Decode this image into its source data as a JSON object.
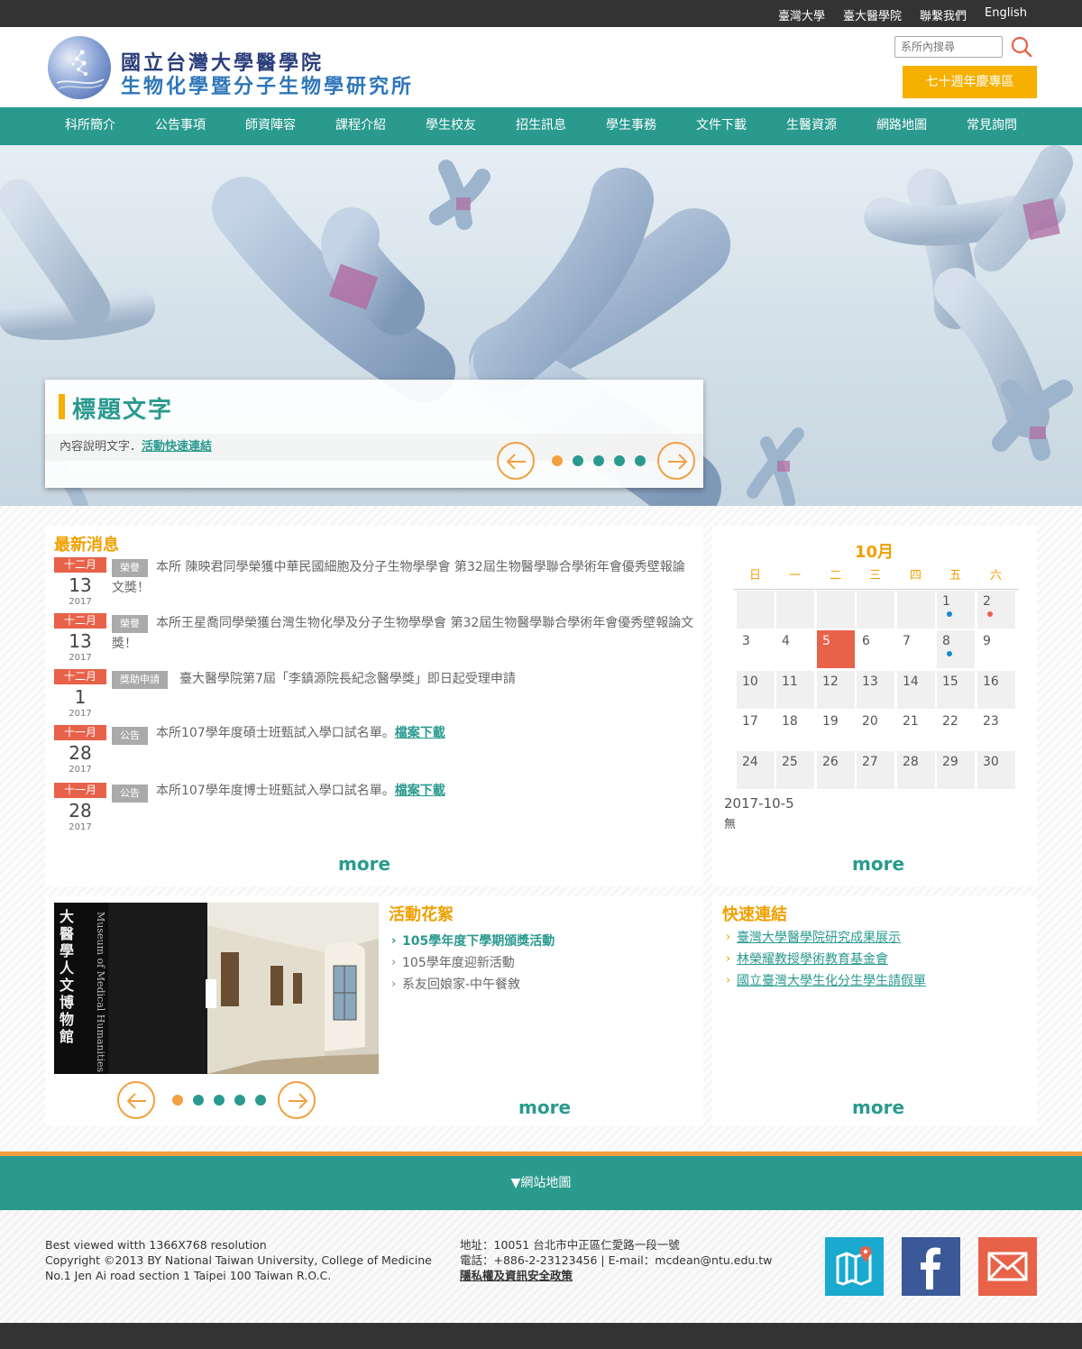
{
  "topbar": {
    "links": [
      "臺灣大學",
      "臺大醫學院",
      "聯繫我們",
      "English"
    ]
  },
  "header": {
    "logo_line1": "國立台灣大學醫學院",
    "logo_line2": "生物化學暨分子生物學研究所",
    "search_placeholder": "系所內搜尋",
    "search_icon": "search-icon",
    "anniversary_button": "七十週年慶專區"
  },
  "nav": {
    "items": [
      "科所簡介",
      "公告事項",
      "師資陣容",
      "課程介紹",
      "學生校友",
      "招生訊息",
      "學生事務",
      "文件下載",
      "生醫資源",
      "網路地圖",
      "常見詢問"
    ]
  },
  "banner": {
    "title": "標題文字",
    "desc": "內容說明文字．",
    "link": "活動快速連結",
    "slide_count": 5,
    "active_slide": 1
  },
  "news": {
    "title": "最新消息",
    "more": "more",
    "items": [
      {
        "month": "十二月",
        "day": "13",
        "year": "2017",
        "tag": "榮譽",
        "text": "本所 陳映君同學榮獲中華民國細胞及分子生物學學會 第32屆生物醫學聯合學術年會優秀壁報論文獎！",
        "link": ""
      },
      {
        "month": "十二月",
        "day": "13",
        "year": "2017",
        "tag": "榮譽",
        "text": "本所王星喬同學榮獲台灣生物化學及分子生物學學會 第32屆生物醫學聯合學術年會優秀壁報論文獎！",
        "link": ""
      },
      {
        "month": "十二月",
        "day": "1",
        "year": "2017",
        "tag": "獎助申請",
        "text": "臺大醫學院第7屆「李鎮源院長紀念醫學獎」即日起受理申請",
        "link": ""
      },
      {
        "month": "十一月",
        "day": "28",
        "year": "2017",
        "tag": "公告",
        "text": "本所107學年度碩士班甄試入學口試名單。",
        "link": "檔案下載"
      },
      {
        "month": "十一月",
        "day": "28",
        "year": "2017",
        "tag": "公告",
        "text": "本所107學年度博士班甄試入學口試名單。",
        "link": "檔案下載"
      }
    ]
  },
  "calendar": {
    "month": "10月",
    "weekdays": [
      "日",
      "一",
      "二",
      "三",
      "四",
      "五",
      "六"
    ],
    "selected_date": "2017-10-5",
    "selected_events": "無",
    "today": 5,
    "event_days": {
      "1": "#1a8ac8",
      "2": "#e8624a",
      "8": "#1a8ac8"
    },
    "more": "more"
  },
  "activity": {
    "title": "活動花絮",
    "items": [
      "105學年度下學期頒獎活動",
      "105學年度迎新活動",
      "系友回娘家-中午餐敘"
    ],
    "slide_count": 5,
    "active_slide": 1,
    "photo_text": "大醫學人文博物館",
    "photo_text_en": "Museum of Medical Humanities",
    "more": "more"
  },
  "quick": {
    "title": "快速連結",
    "items": [
      "臺灣大學醫學院研究成果展示",
      "林榮耀教授學術教育基金會",
      "國立臺灣大學生化分生學生請假單"
    ],
    "more": "more"
  },
  "footer": {
    "sitemap": "▼網站地圖",
    "left": [
      "Best viewed witth 1366X768 resolution",
      "Copyright ©2013 BY National Taiwan University, College of Medicine",
      "No.1 Jen Ai road section 1 Taipei 100 Taiwan R.O.C."
    ],
    "address": "地址：10051 台北市中正區仁愛路一段一號",
    "contact": "電話：+886-2-23123456 | E-mail：mcdean@ntu.edu.tw",
    "privacy": "隱私權及資訊安全政策",
    "colors": {
      "map": "#1aaad0",
      "facebook": "#3b5998",
      "mail": "#e8624a"
    }
  }
}
